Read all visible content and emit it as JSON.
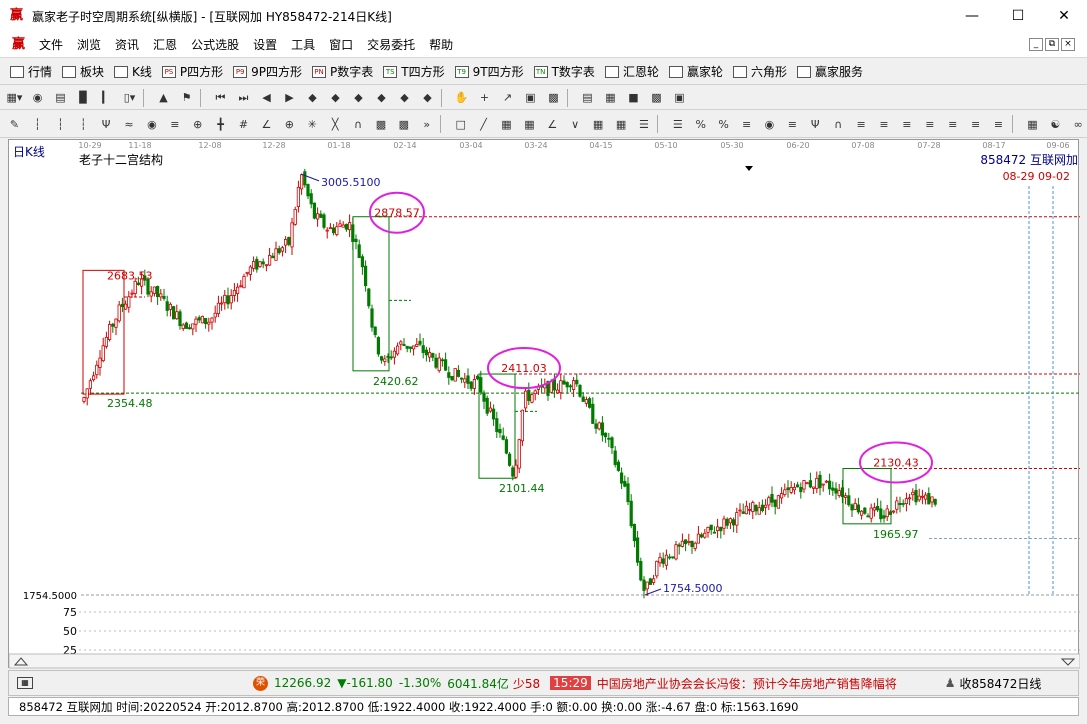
{
  "window": {
    "title": "赢家老子时空周期系统[纵横版] - [互联网加  HY858472-214日K线]",
    "logo": "赢"
  },
  "menu": {
    "logo": "赢",
    "items": [
      "文件",
      "浏览",
      "资讯",
      "汇恩",
      "公式选股",
      "设置",
      "工具",
      "窗口",
      "交易委托",
      "帮助"
    ]
  },
  "toolbar1": [
    "行情",
    "板块",
    "K线",
    "P四方形",
    "9P四方形",
    "P数字表",
    "T四方形",
    "9T四方形",
    "T数字表",
    "汇恩轮",
    "赢家轮",
    "六角形",
    "赢家服务"
  ],
  "toolbar1_icons": [
    "PS",
    "P9",
    "PN",
    "TS",
    "T9",
    "TN"
  ],
  "chart": {
    "period_label": "日K线",
    "indicator_label": "老子十二宫结构",
    "code_label": "858472 互联网加",
    "date_marker": "08-29 09-02",
    "date_ticks": [
      "10-29",
      "11-18",
      "12-08",
      "12-28",
      "01-18",
      "02-14",
      "03-04",
      "03-24",
      "04-15",
      "05-10",
      "05-30",
      "06-20",
      "07-08",
      "07-28",
      "08-17",
      "09-06"
    ],
    "high_label": "3005.5100",
    "low_label": "1754.5000",
    "axis_low_label": "1754.5000",
    "vol_ticks": [
      "75",
      "50",
      "25"
    ],
    "circled_levels": [
      "2878.57",
      "2411.03",
      "2130.43"
    ],
    "box_labels": [
      "2683.53",
      "2354.48",
      "2420.62",
      "2101.44",
      "1965.97"
    ],
    "accent_red": "#d00000",
    "accent_green": "#007a00",
    "circle_color": "#e020e0"
  },
  "status": {
    "index_value": "12266.92",
    "index_change": "▼-161.80",
    "index_pct": "-1.30%",
    "index_amount": "6041.84亿",
    "tick_label": "少58",
    "time": "15:29",
    "news": "中国房地产业协会会长冯俊：预计今年房地产销售降幅将",
    "right_label": "收858472日线"
  },
  "info": "858472 互联网加 时间:20220524 开:2012.8700 高:2012.8700 低:1922.4000 收:1922.4000 手:0 额:0.00 换:0.00 涨:-4.67 盘:0 标:1563.1690"
}
